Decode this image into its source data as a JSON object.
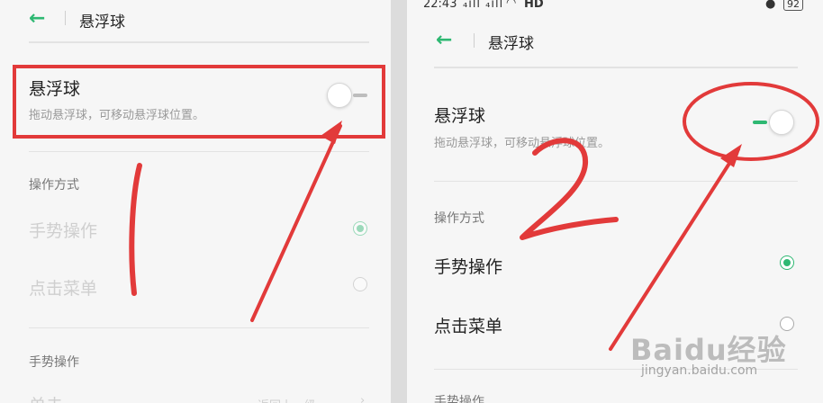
{
  "left": {
    "header_title": "悬浮球",
    "feature_title": "悬浮球",
    "feature_desc": "拖动悬浮球，可移动悬浮球位置。",
    "section_mode": "操作方式",
    "opt_gesture": "手势操作",
    "opt_menu": "点击菜单",
    "section_gesture": "手势操作",
    "row_single": "单击",
    "row_single_value": "返回上一级",
    "toggle_on": false,
    "selected_option": "手势操作"
  },
  "right": {
    "status": {
      "time": "22:43",
      "signal": "₄ıll ₄ıll",
      "network": "HD",
      "battery": "92"
    },
    "header_title": "悬浮球",
    "feature_title": "悬浮球",
    "feature_desc": "拖动悬浮球，可移动悬浮球位置。",
    "section_mode": "操作方式",
    "opt_gesture": "手势操作",
    "opt_menu": "点击菜单",
    "section_gesture": "手势操作",
    "toggle_on": true,
    "selected_option": "手势操作"
  },
  "annotations": {
    "step1": "1",
    "step2": "2",
    "color": "#e23a3a"
  },
  "watermark": {
    "brand": "Baidu经验",
    "url": "jingyan.baidu.com"
  },
  "colors": {
    "accent": "#2eb872",
    "annotation": "#e23a3a"
  }
}
